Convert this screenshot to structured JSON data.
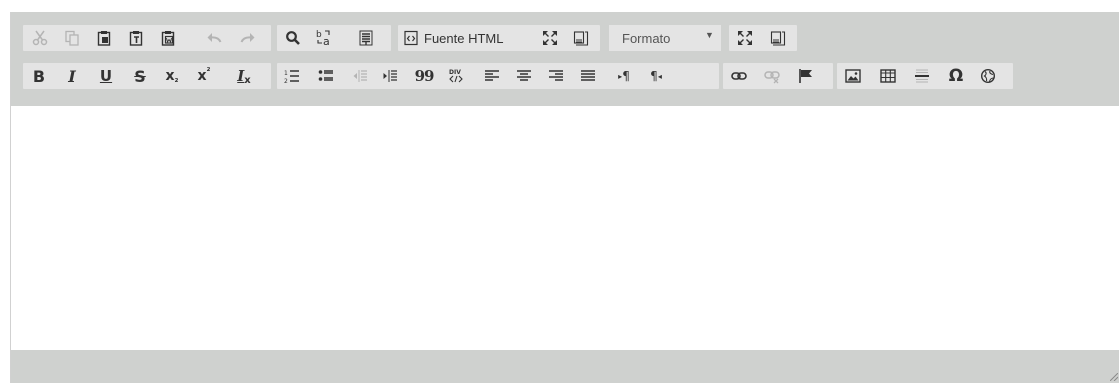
{
  "toolbar": {
    "source_label": "Fuente HTML",
    "format_label": "Formato",
    "text_buttons": {
      "bold": "B",
      "italic": "I",
      "underline": "U",
      "strike": "S",
      "subscript_base": "x",
      "subscript_mark": "₂",
      "superscript_base": "x",
      "superscript_mark": "²",
      "removeformat_base": "I",
      "removeformat_mark": "x",
      "blockquote": "99",
      "special_char": "Ω",
      "bidi_ltr": "¶",
      "bidi_rtl": "¶"
    }
  },
  "icons": [
    "cut-icon",
    "copy-icon",
    "paste-icon",
    "paste-text-icon",
    "paste-word-icon",
    "undo-icon",
    "redo-icon",
    "find-icon",
    "replace-icon",
    "select-all-icon",
    "source-icon",
    "maximize-icon",
    "show-blocks-icon",
    "bold-icon",
    "italic-icon",
    "underline-icon",
    "strikethrough-icon",
    "subscript-icon",
    "superscript-icon",
    "remove-format-icon",
    "numbered-list-icon",
    "bulleted-list-icon",
    "outdent-icon",
    "indent-icon",
    "blockquote-icon",
    "div-icon",
    "align-left-icon",
    "align-center-icon",
    "align-right-icon",
    "justify-icon",
    "bidi-ltr-icon",
    "bidi-rtl-icon",
    "link-icon",
    "unlink-icon",
    "anchor-icon",
    "image-icon",
    "table-icon",
    "horizontal-rule-icon",
    "special-char-icon",
    "iframe-icon"
  ],
  "colors": {
    "bar": "#cfd1cf",
    "button_group": "#e4e4e4",
    "icon": "#333333",
    "icon_disabled": "#b4b4b4"
  }
}
